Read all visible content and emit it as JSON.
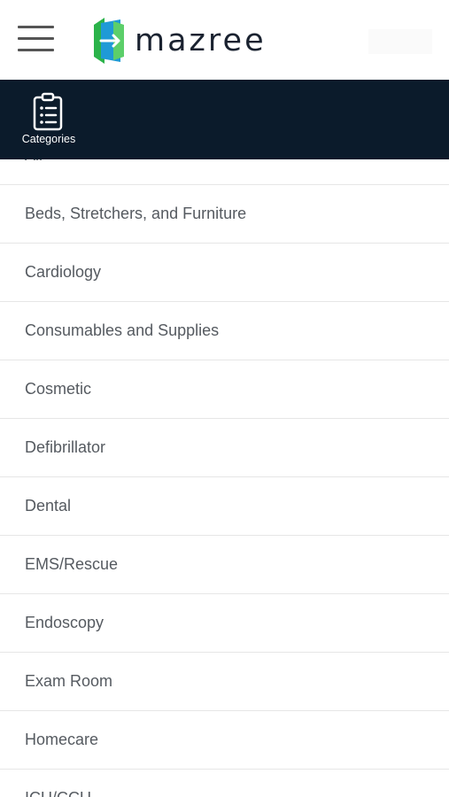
{
  "header": {
    "brand": "mazree",
    "menu_icon": "hamburger-menu-icon",
    "logo_icon": "mazree-logo-icon",
    "logo_colors": [
      "#2bb34a",
      "#1f9ad6",
      "#5ccf6a"
    ]
  },
  "category_bar": {
    "label": "Categories",
    "icon": "clipboard-list-icon",
    "background": "#0b1b2b"
  },
  "categories": [
    "All",
    "Beds, Stretchers, and Furniture",
    "Cardiology",
    "Consumables and Supplies",
    "Cosmetic",
    "Defibrillator",
    "Dental",
    "EMS/Rescue",
    "Endoscopy",
    "Exam Room",
    "Homecare",
    "ICU/CCU"
  ]
}
